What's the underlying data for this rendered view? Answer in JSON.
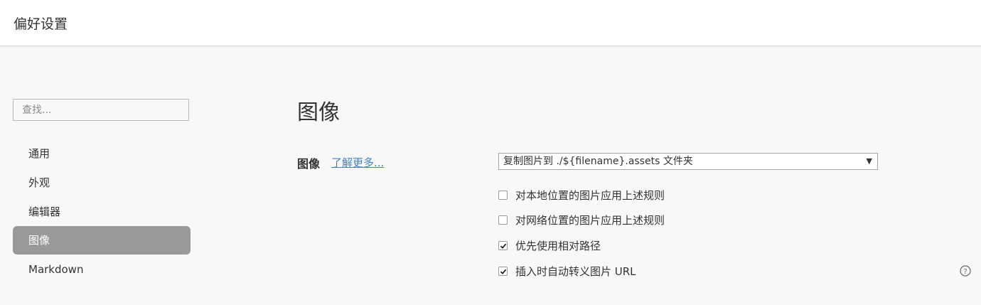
{
  "window": {
    "title": "偏好设置"
  },
  "sidebar": {
    "search_placeholder": "查找...",
    "items": [
      {
        "label": "通用",
        "active": false
      },
      {
        "label": "外观",
        "active": false
      },
      {
        "label": "编辑器",
        "active": false
      },
      {
        "label": "图像",
        "active": true
      },
      {
        "label": "Markdown",
        "active": false
      }
    ]
  },
  "main": {
    "section_title": "图像",
    "image_row": {
      "label": "图像",
      "learn_more": "了解更多...",
      "select_value": "复制图片到 ./${filename}.assets 文件夹"
    },
    "options": [
      {
        "label": "对本地位置的图片应用上述规则",
        "checked": false
      },
      {
        "label": "对网络位置的图片应用上述规则",
        "checked": false
      },
      {
        "label": "优先使用相对路径",
        "checked": true
      },
      {
        "label": "插入时自动转义图片 URL",
        "checked": true
      }
    ]
  },
  "colors": {
    "accent_link": "#4183c4",
    "active_nav_bg": "#999999"
  }
}
